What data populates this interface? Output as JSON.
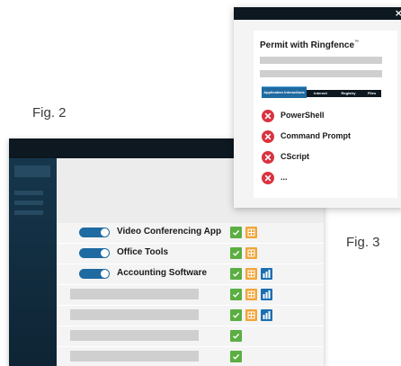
{
  "figures": {
    "fig2_label": "Fig. 2",
    "fig3_label": "Fig. 3"
  },
  "fig2": {
    "apps": [
      {
        "name": "Video Conferencing App",
        "enabled": true,
        "badges": [
          "check-icon",
          "file-icon"
        ]
      },
      {
        "name": "Office Tools",
        "enabled": true,
        "badges": [
          "check-icon",
          "file-icon"
        ]
      },
      {
        "name": "Accounting Software",
        "enabled": true,
        "badges": [
          "check-icon",
          "file-icon",
          "network-icon"
        ]
      },
      {
        "name": "",
        "enabled": null,
        "badges": [
          "check-icon",
          "file-icon",
          "network-icon"
        ]
      },
      {
        "name": "",
        "enabled": null,
        "badges": [
          "check-icon",
          "file-icon",
          "network-icon"
        ]
      },
      {
        "name": "",
        "enabled": null,
        "badges": [
          "check-icon"
        ]
      },
      {
        "name": "",
        "enabled": null,
        "badges": [
          "check-icon"
        ]
      }
    ],
    "colors": {
      "toggle": "#1e6aa1",
      "check": "#5bae42",
      "file": "#f0a63b",
      "network": "#1b6fb0"
    }
  },
  "fig3": {
    "title": "Permit with Ringfence",
    "trademark": "™",
    "close": "×",
    "tabs": [
      "Application Interactions",
      "Internet",
      "Registry",
      "Files"
    ],
    "blocked_items": [
      "PowerShell",
      "Command Prompt",
      "CScript",
      "..."
    ],
    "colors": {
      "blocked": "#d9333f",
      "active_tab": "#1e6aa1"
    }
  }
}
